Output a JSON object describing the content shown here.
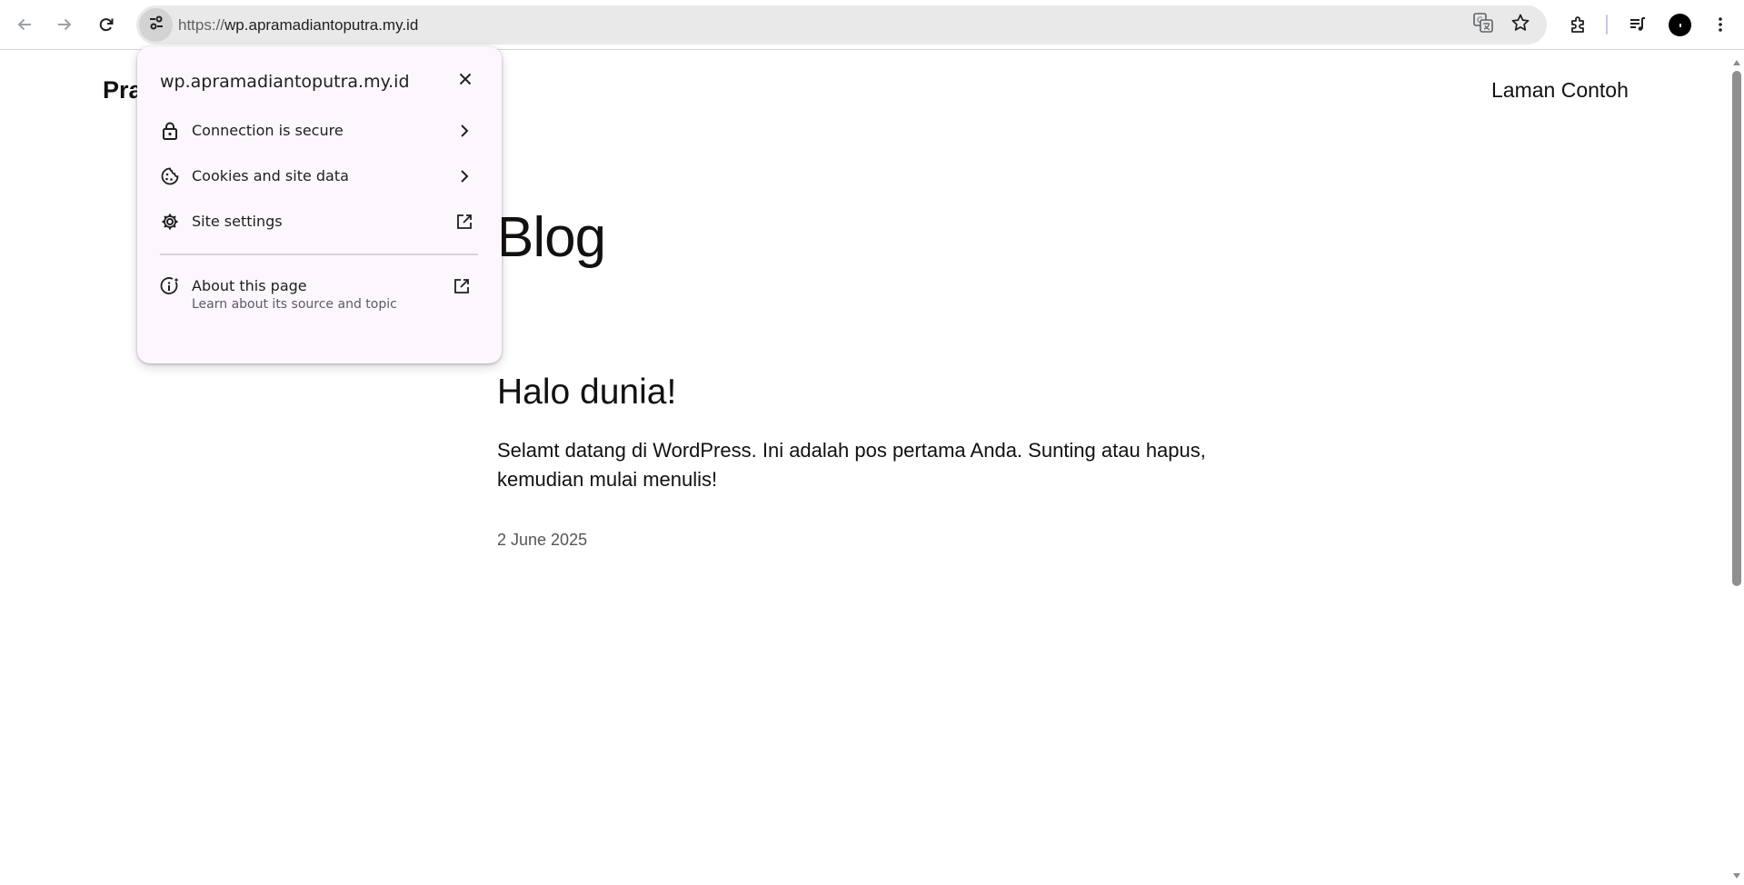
{
  "browser": {
    "url_scheme": "https://",
    "url_host": "wp.apramadiantoputra.my.id",
    "icons": {
      "back": "arrow-left-icon",
      "forward": "arrow-right-icon",
      "reload": "reload-icon",
      "site_info": "tune-icon",
      "translate": "translate-icon",
      "bookmark": "star-icon",
      "extensions": "puzzle-icon",
      "media": "queue-music-icon",
      "profile": "avatar",
      "menu": "kebab-menu-icon"
    }
  },
  "site": {
    "title": "Pra",
    "nav": [
      "Laman Contoh"
    ]
  },
  "main": {
    "heading": "Blog",
    "post": {
      "title": "Halo dunia!",
      "excerpt": "Selamt datang di WordPress. Ini adalah pos pertama Anda. Sunting atau hapus, kemudian mulai menulis!",
      "date": "2 June 2025"
    }
  },
  "site_info_popup": {
    "domain": "wp.apramadiantoputra.my.id",
    "items": [
      {
        "label": "Connection is secure",
        "icon": "lock-icon",
        "end_icon": "chevron-right-icon"
      },
      {
        "label": "Cookies and site data",
        "icon": "cookie-icon",
        "end_icon": "chevron-right-icon"
      },
      {
        "label": "Site settings",
        "icon": "gear-icon",
        "end_icon": "open-in-new-icon"
      }
    ],
    "about": {
      "label": "About this page",
      "sublabel": "Learn about its source and topic",
      "icon": "info-spark-icon",
      "end_icon": "open-in-new-icon"
    }
  },
  "colors": {
    "popup_bg": "#fcf7fc",
    "omnibox_bg": "#e9e9e9",
    "scroll_thumb": "#8f8f8f"
  }
}
